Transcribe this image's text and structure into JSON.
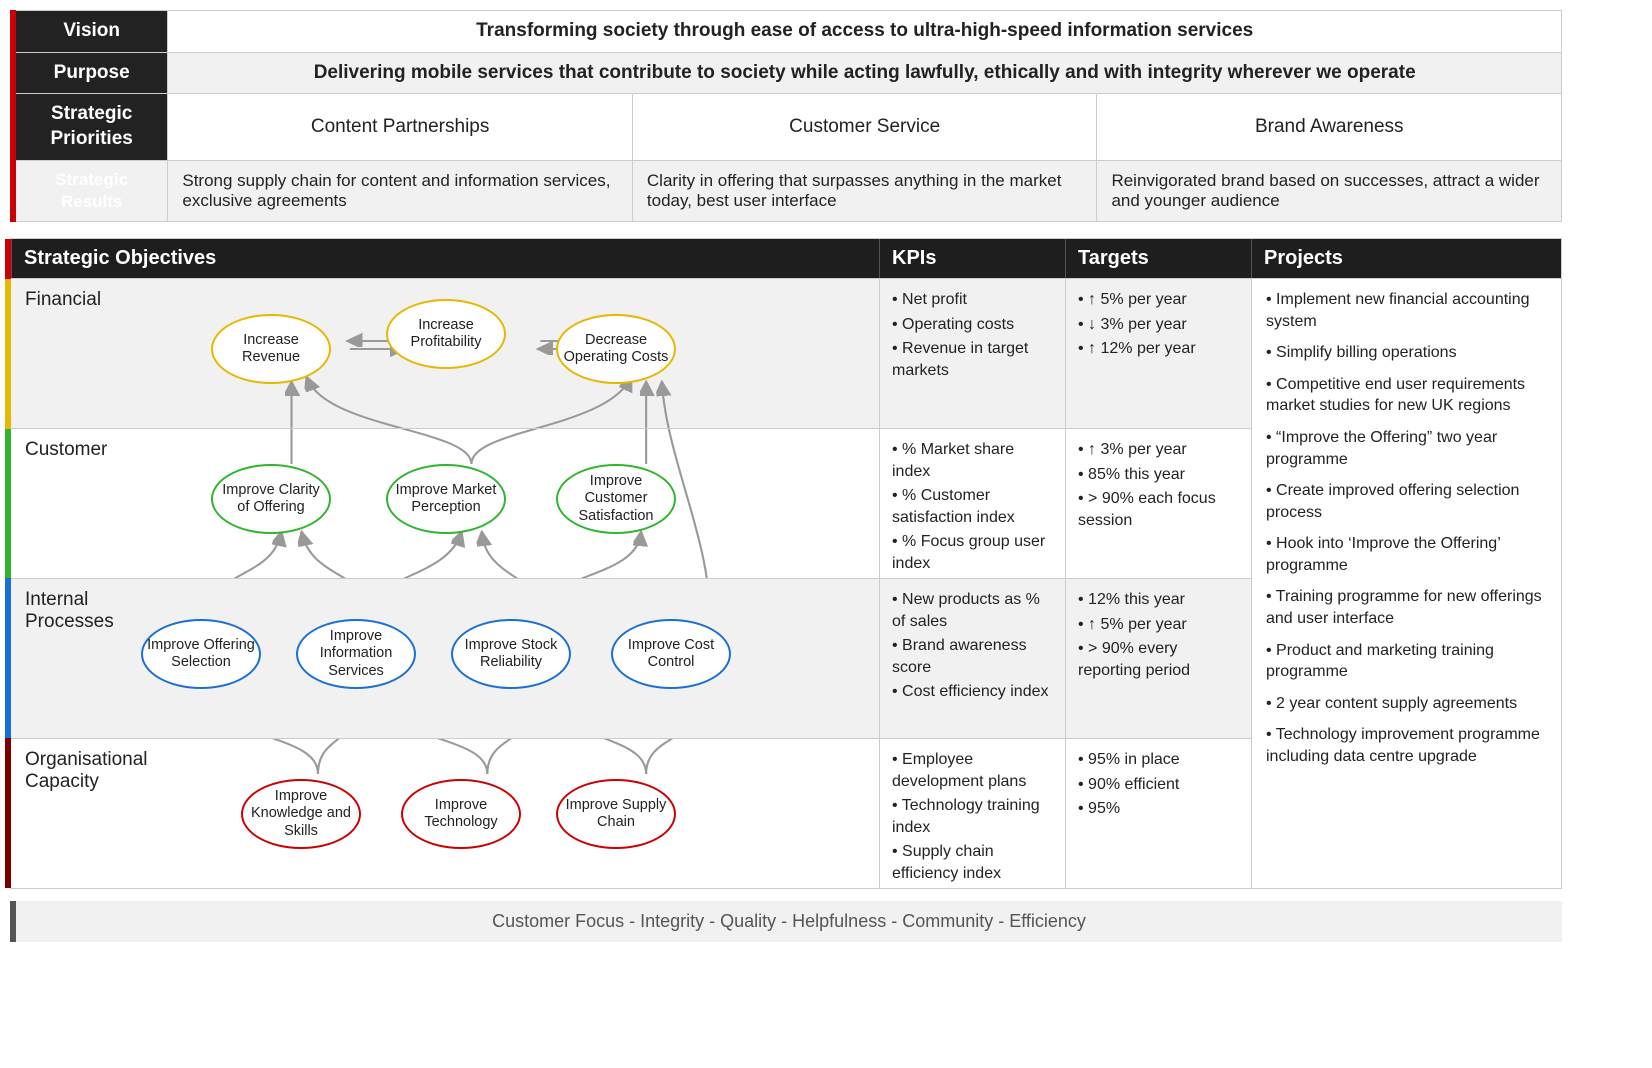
{
  "top": {
    "vision_label": "Vision",
    "vision_text": "Transforming society through ease of access to ultra-high-speed information services",
    "purpose_label": "Purpose",
    "purpose_text": "Delivering mobile services that contribute to society while acting lawfully, ethically and with integrity wherever we operate",
    "priorities_label": "Strategic Priorities",
    "priorities": [
      "Content Partnerships",
      "Customer Service",
      "Brand Awareness"
    ],
    "results_label": "Strategic Results",
    "results": [
      "Strong supply chain for content and information services, exclusive agreements",
      "Clarity in offering that surpasses anything in the market today, best user interface",
      "Reinvigorated brand based on successes, attract a wider and younger audience"
    ]
  },
  "headers": {
    "so": "Strategic Objectives",
    "kpis": "KPIs",
    "targets": "Targets",
    "projects": "Projects"
  },
  "perspectives": [
    {
      "name": "Financial",
      "kpis": [
        "Net profit",
        "Operating costs",
        "Revenue in target markets"
      ],
      "targets": [
        "↑ 5% per year",
        "↓ 3% per year",
        "↑ 12% per year"
      ]
    },
    {
      "name": "Customer",
      "kpis": [
        "% Market share index",
        "% Customer satisfaction index",
        "% Focus group user index"
      ],
      "targets": [
        "↑ 3% per year",
        "85% this year",
        "> 90% each focus session"
      ]
    },
    {
      "name": "Internal Processes",
      "kpis": [
        "New products as % of sales",
        "Brand awareness score",
        "Cost efficiency index"
      ],
      "targets": [
        "12% this year",
        "↑ 5% per year",
        "> 90% every reporting period"
      ]
    },
    {
      "name": "Organisational Capacity",
      "kpis": [
        "Employee development plans",
        "Technology training index",
        "Supply chain efficiency index"
      ],
      "targets": [
        "95% in place",
        "90% efficient",
        "95%"
      ]
    }
  ],
  "projects": [
    "Implement new financial accounting system",
    "Simplify billing operations",
    "Competitive end user requirements market studies for new UK regions",
    "“Improve the Offering” two year programme",
    "Create improved offering selection process",
    "Hook into ‘Improve the Offering’ programme",
    "Training programme for new offerings and user interface",
    "Product and marketing training programme",
    "2 year content supply agreements",
    "Technology improvement programme including data centre upgrade"
  ],
  "nodes": {
    "fin": [
      "Increase Revenue",
      "Increase Profitability",
      "Decrease Operating Costs"
    ],
    "cust": [
      "Improve Clarity of Offering",
      "Improve Market Perception",
      "Improve Customer Satisfaction"
    ],
    "int": [
      "Improve Offering Selection",
      "Improve Information Services",
      "Improve Stock Reliability",
      "Improve Cost Control"
    ],
    "org": [
      "Improve Knowledge and Skills",
      "Improve Technology",
      "Improve Supply Chain"
    ]
  },
  "values": "Customer Focus    -    Integrity    -    Quality    -    Helpfulness    -    Community    -    Efficiency"
}
